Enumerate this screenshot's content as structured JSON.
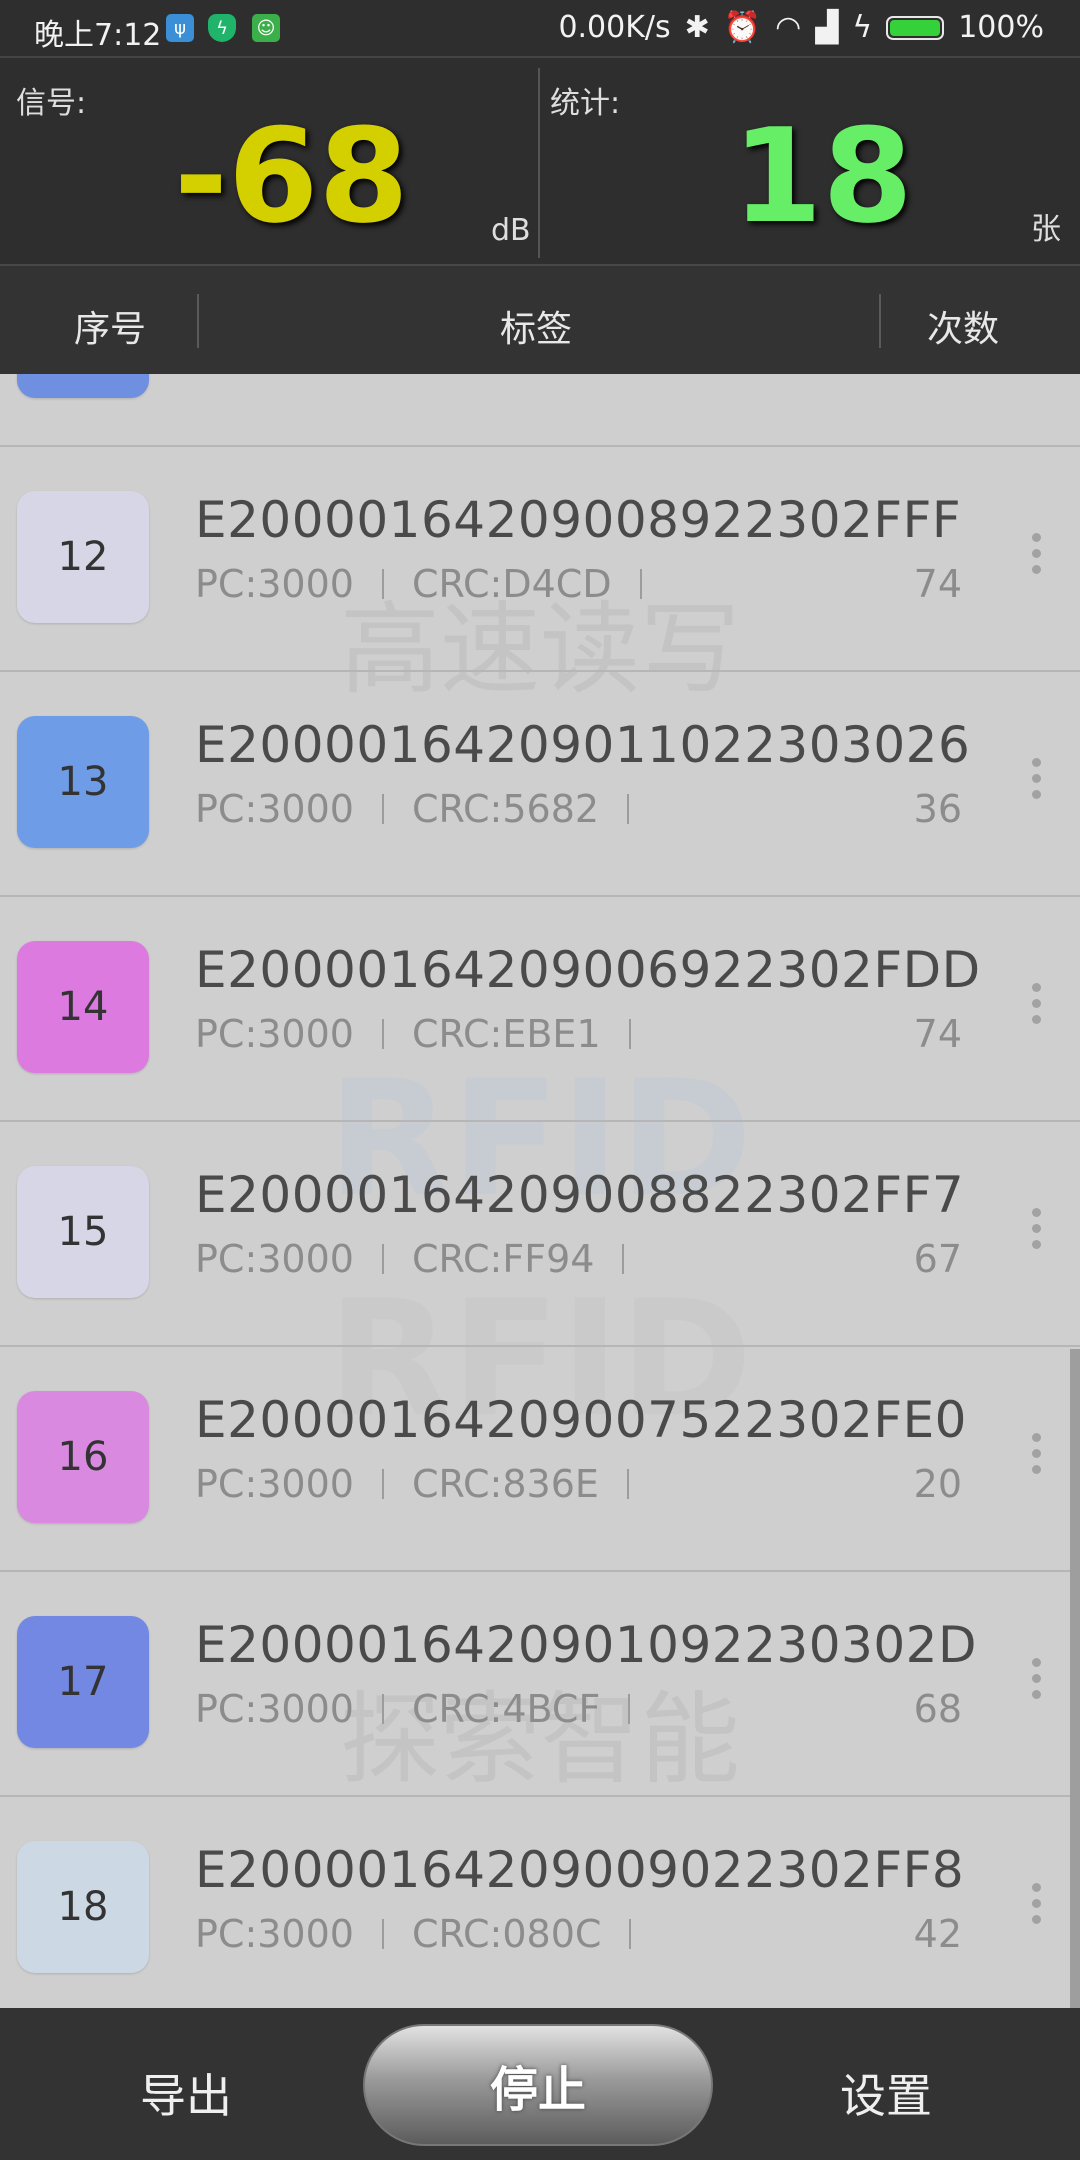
{
  "status_bar": {
    "time": "晚上7:12",
    "net_speed": "0.00K/s",
    "battery": "100%",
    "icons": [
      "usb-icon",
      "shield-icon",
      "android-icon",
      "bluetooth-icon",
      "alarm-icon",
      "wifi-icon",
      "signal-icon",
      "charging-icon",
      "battery-icon"
    ]
  },
  "panel": {
    "signal_label": "信号:",
    "signal_value": "-68",
    "signal_unit": "dB",
    "signal_color": "#d4d000",
    "count_label": "统计:",
    "count_value": "18",
    "count_unit": "张",
    "count_color": "#66ee66"
  },
  "columns": {
    "index": "序号",
    "tag": "标签",
    "times": "次数"
  },
  "watermark": {
    "line1": "高速读写",
    "line2": "RFID",
    "line3": "探索智能"
  },
  "rows": [
    {
      "index": "12",
      "epc": "E2000016420900892230​2FFF",
      "pc": "PC:3000",
      "crc": "CRC:D4CD",
      "count": "74",
      "color": "#d6d6e6"
    },
    {
      "index": "13",
      "epc": "E20000164209011022303026",
      "pc": "PC:3000",
      "crc": "CRC:5682",
      "count": "36",
      "color": "#6f9ce6"
    },
    {
      "index": "14",
      "epc": "E2000016420900692230​2FDD",
      "pc": "PC:3000",
      "crc": "CRC:EBE1",
      "count": "74",
      "color": "#dc7adf"
    },
    {
      "index": "15",
      "epc": "E2000016420900882230​2FF7",
      "pc": "PC:3000",
      "crc": "CRC:FF94",
      "count": "67",
      "color": "#d6d6e6"
    },
    {
      "index": "16",
      "epc": "E2000016420900752230​2FE0",
      "pc": "PC:3000",
      "crc": "CRC:836E",
      "count": "20",
      "color": "#d98ae0"
    },
    {
      "index": "17",
      "epc": "E2000016420901092230302D",
      "pc": "PC:3000",
      "crc": "CRC:4BCF",
      "count": "68",
      "color": "#7288e2"
    },
    {
      "index": "18",
      "epc": "E2000016420900902230​2FF8",
      "pc": "PC:3000",
      "crc": "CRC:080C",
      "count": "42",
      "color": "#ccd8e3"
    }
  ],
  "partial_row_color": "#6f8fe0",
  "bottom": {
    "export": "导出",
    "stop": "停止",
    "settings": "设置"
  }
}
